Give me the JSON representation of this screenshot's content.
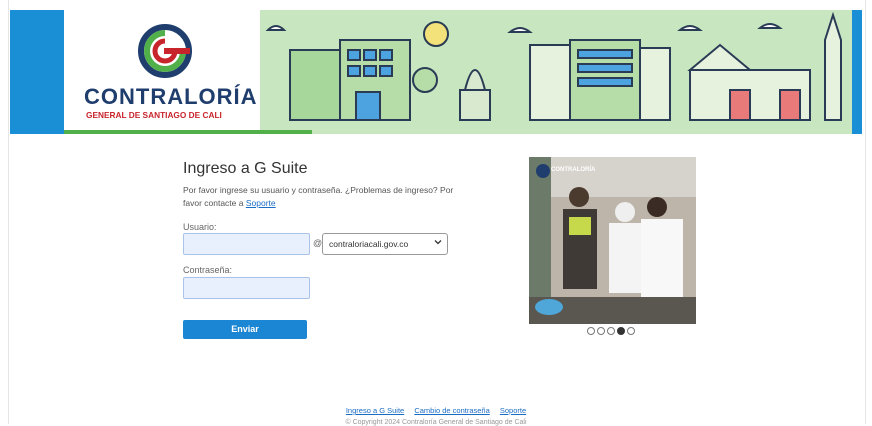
{
  "brand": {
    "name": "CONTRALORÍA",
    "subtitle": "GENERAL DE SANTIAGO DE CALI",
    "colors": {
      "blue": "#1b8fd6",
      "green": "#52b04a",
      "red": "#c8242b",
      "navy": "#1f3e6e"
    }
  },
  "login": {
    "title": "Ingreso a G Suite",
    "intro": "Por favor ingrese su usuario y contraseña. ¿Problemas de ingreso? Por favor contacte a",
    "support_link": "Soporte",
    "username_label": "Usuario:",
    "username_value": "",
    "at_sign": "@",
    "domain_selected": "contraloriacali.gov.co",
    "password_label": "Contraseña:",
    "password_value": "",
    "submit_label": "Enviar"
  },
  "carousel": {
    "photo_caption": "CONTRALORÍA",
    "slide_count": 5,
    "active_index": 3
  },
  "footer": {
    "links": [
      "Ingreso a G Suite",
      "Cambio de contraseña",
      "Soporte"
    ],
    "copyright": "© Copyright 2024 Contraloría General de Santiago de Cali"
  }
}
